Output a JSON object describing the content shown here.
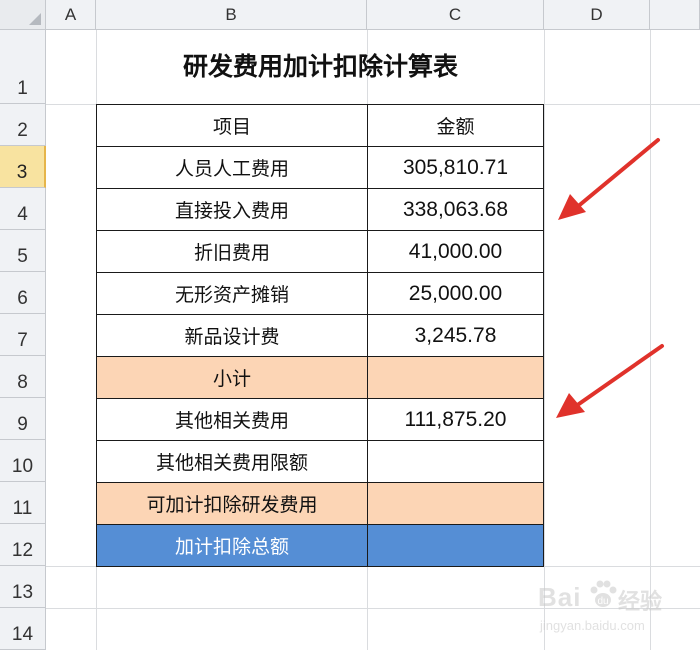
{
  "columns": [
    "A",
    "B",
    "C",
    "D"
  ],
  "rows": [
    "1",
    "2",
    "3",
    "4",
    "5",
    "6",
    "7",
    "8",
    "9",
    "10",
    "11",
    "12",
    "13",
    "14"
  ],
  "selected_row": "3",
  "title": "研发费用加计扣除计算表",
  "header": {
    "item": "项目",
    "amount": "金额"
  },
  "table_rows": [
    {
      "label": "人员人工费用",
      "amount": "305,810.71",
      "highlight": "none"
    },
    {
      "label": "直接投入费用",
      "amount": "338,063.68",
      "highlight": "none"
    },
    {
      "label": "折旧费用",
      "amount": "41,000.00",
      "highlight": "none"
    },
    {
      "label": "无形资产摊销",
      "amount": "25,000.00",
      "highlight": "none"
    },
    {
      "label": "新品设计费",
      "amount": "3,245.78",
      "highlight": "none"
    },
    {
      "label": "小计",
      "amount": "",
      "highlight": "peach"
    },
    {
      "label": "其他相关费用",
      "amount": "111,875.20",
      "highlight": "none"
    },
    {
      "label": "其他相关费用限额",
      "amount": "",
      "highlight": "none"
    },
    {
      "label": "可加计扣除研发费用",
      "amount": "",
      "highlight": "peach"
    },
    {
      "label": "加计扣除总额",
      "amount": "",
      "highlight": "blue"
    }
  ],
  "colors": {
    "peach": "#fcd5b5",
    "blue": "#558ed5",
    "arrow": "#e0322b",
    "selected_row": "#f8e3a0"
  },
  "annotations": [
    {
      "name": "red-arrow-icon",
      "points_to_row": "4"
    },
    {
      "name": "red-arrow-icon",
      "points_to_row": "9"
    }
  ],
  "watermark": {
    "brand": "Bai",
    "brand2": "经验",
    "url": "jingyan.baidu.com"
  }
}
